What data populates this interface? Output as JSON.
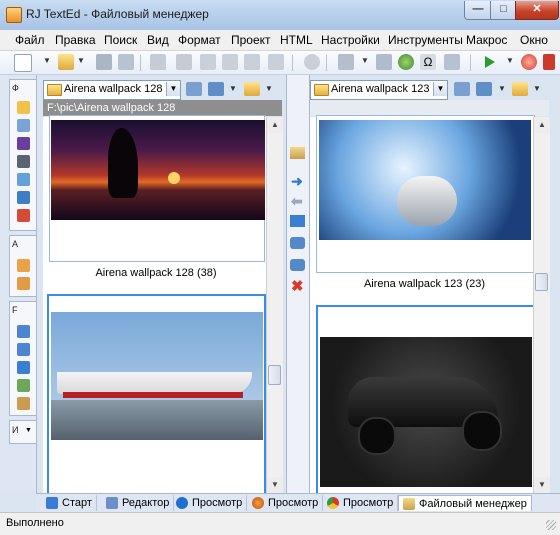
{
  "window": {
    "title": "RJ TextEd - Файловый менеджер",
    "minimize_glyph": "—",
    "maximize_glyph": "□",
    "close_glyph": "✕"
  },
  "menu": {
    "items": [
      {
        "label": "Файл"
      },
      {
        "label": "Правка"
      },
      {
        "label": "Поиск"
      },
      {
        "label": "Вид"
      },
      {
        "label": "Формат"
      },
      {
        "label": "Проект"
      },
      {
        "label": "HTML"
      },
      {
        "label": "Настройки"
      },
      {
        "label": "Инструменты"
      },
      {
        "label": "Макрос"
      },
      {
        "label": "Окно"
      }
    ]
  },
  "left_strip": {
    "group_headers": [
      "Ф",
      "А",
      "F",
      "И"
    ]
  },
  "left_pane": {
    "folder": "Airena wallpack 128",
    "path": "F:\\pic\\Airena wallpack 128",
    "thumb1_caption": "Airena wallpack 128 (38)"
  },
  "right_pane": {
    "folder": "Airena wallpack 123",
    "thumb1_caption": "Airena wallpack 123 (23)"
  },
  "tabs": [
    {
      "label": "Старт",
      "icon": "home-icon",
      "color": "#3a7bd5"
    },
    {
      "label": "Редактор",
      "icon": "document-edit-icon",
      "color": "#6b8fc9"
    },
    {
      "label": "Просмотр",
      "icon": "ie-browser-icon",
      "color": "#1f6fd0"
    },
    {
      "label": "Просмотр",
      "icon": "firefox-browser-icon",
      "color": "#e46a1c"
    },
    {
      "label": "Просмотр",
      "icon": "chrome-browser-icon",
      "color": "#3a9a3a"
    },
    {
      "label": "Файловый менеджер",
      "icon": "file-manager-icon",
      "color": "#c9a44a"
    }
  ],
  "status": {
    "text": "Выполнено"
  },
  "colors": {
    "accent": "#3b8ce6",
    "pathbar": "#8e8e8e",
    "delete_red": "#d93a2b"
  }
}
